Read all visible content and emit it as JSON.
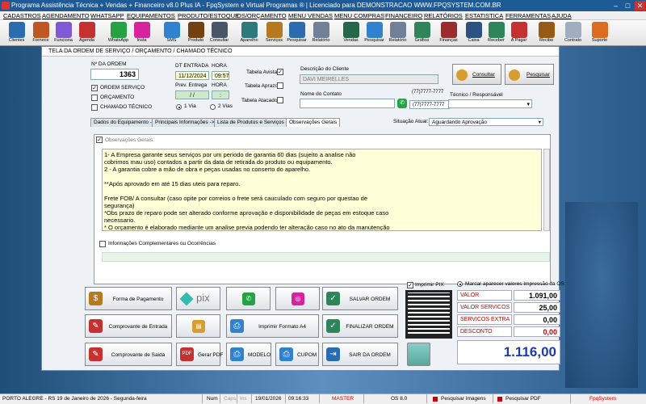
{
  "window": {
    "title": "Programa Assistência Técnica + Vendas + Financeiro v8.0 Plus IA - FpqSystem e Virtual Programas ® | Licenciado para  DEMONSTRACAO WWW.FPQSYSTEM.COM.BR"
  },
  "menu": [
    "CADASTROS",
    "AGENDAMENTO",
    "WHATSAPP",
    "EQUIPAMENTOS",
    "PRODUTO/ESTOQUE",
    "OS/ORÇAMENTO",
    "MENU VENDAS",
    "MENU COMPRAS",
    "FINANCEIRO",
    "RELATÓRIOS",
    "ESTATISTICA",
    "FERRAMENTAS",
    "AJUDA"
  ],
  "toolbar": [
    {
      "label": "Clientes",
      "icon": "clients-icon",
      "color": "#2b6cb0"
    },
    {
      "label": "Fornece",
      "icon": "suppliers-icon",
      "color": "#c05621"
    },
    {
      "label": "Funciona",
      "icon": "employees-icon",
      "color": "#805ad5"
    },
    {
      "label": "Agenda",
      "icon": "calendar-icon",
      "color": "#c53030"
    },
    {
      "label": "WhatsApp",
      "icon": "whatsapp-icon",
      "color": "#25a244"
    },
    {
      "label": "Insta",
      "icon": "instagram-icon",
      "color": "#d6249f"
    },
    {
      "label": "SMS",
      "icon": "sms-icon",
      "color": "#3182ce"
    },
    {
      "label": "Produto",
      "icon": "product-icon",
      "color": "#744210"
    },
    {
      "label": "Consultar",
      "icon": "consult-icon",
      "color": "#4a5568"
    },
    {
      "label": "Aparelho",
      "icon": "device-icon",
      "color": "#2c7a7b"
    },
    {
      "label": "Serviços",
      "icon": "services-icon",
      "color": "#b7791f"
    },
    {
      "label": "Pesquisar",
      "icon": "search-service-icon",
      "color": "#2b6cb0"
    },
    {
      "label": "Relatório",
      "icon": "report-icon",
      "color": "#718096"
    },
    {
      "label": "Vendas",
      "icon": "cart-icon",
      "color": "#276749"
    },
    {
      "label": "Pesquisar",
      "icon": "search-sales-icon",
      "color": "#3182ce"
    },
    {
      "label": "Relatório",
      "icon": "sales-report-icon",
      "color": "#718096"
    },
    {
      "label": "Gráfico",
      "icon": "chart-icon",
      "color": "#2f855a"
    },
    {
      "label": "Finanças",
      "icon": "finance-icon",
      "color": "#9b2c2c"
    },
    {
      "label": "Caixa",
      "icon": "cashier-icon",
      "color": "#2c5282"
    },
    {
      "label": "Receber",
      "icon": "receive-icon",
      "color": "#2f855a"
    },
    {
      "label": "A Pagar",
      "icon": "pay-icon",
      "color": "#c53030"
    },
    {
      "label": "Recibo",
      "icon": "receipt-icon",
      "color": "#975a16"
    },
    {
      "label": "Contrato",
      "icon": "contract-icon",
      "color": "#a0aec0"
    },
    {
      "label": "Suporte",
      "icon": "support-icon",
      "color": "#dd6b20"
    }
  ],
  "form": {
    "title": "TELA DA ORDEM DE SERVIÇO / ORÇAMENTO / CHAMADO TÉCNICO",
    "order_number_label": "Nº DA ORDEM",
    "order_number": "1363",
    "type_options": [
      {
        "label": "ORDEM SERVIÇO",
        "checked": true
      },
      {
        "label": "ORÇAMENTO",
        "checked": false
      },
      {
        "label": "CHAMADO TÉCNICO",
        "checked": false
      }
    ],
    "entry_date_label": "DT ENTRADA",
    "entry_time_label": "HORA",
    "entry_date": "11/12/2024",
    "entry_time": "09:57",
    "delivery_date_label": "Prev. Entrega",
    "delivery_time_label": "HORA",
    "delivery_date": "/  /",
    "delivery_time": ":",
    "copies": [
      {
        "label": "1 Via",
        "selected": true
      },
      {
        "label": "2 Vias",
        "selected": false
      }
    ],
    "price_tables": [
      {
        "label": "Tabela Avista",
        "checked": true
      },
      {
        "label": "Tabela Aprazo",
        "checked": false
      },
      {
        "label": "Tabela Atacado",
        "checked": false
      }
    ],
    "client_label": "Descrição do Cliente",
    "client_name": "DAVI MEIRELLES",
    "contact_label": "Nome do Contato",
    "contact_value": "",
    "phone1": "(77)7777-7777",
    "phone2": "(77)7777-7777",
    "tech_label": "Técnico / Responsável",
    "tech_value": "",
    "consult_button": "Consultar",
    "search_button": "Pesquisar",
    "tabs": [
      "Dados do Equipamento ->",
      "Principais Informações ->",
      "Lista de Produtos e Serviços ->",
      "Observações Gerais"
    ],
    "status_label": "Situação Atual:",
    "status_value": "Aguardando Aprovação",
    "obs_label": "Observações Gerais:",
    "notes": "1- A Empresa garante seus serviços por um periodo de garantia 60 dias (sujeito a analise não\ncobrimos mau uso) contados a partir da data de retirada do produto ou equipamento.\n2 - A garantia cobre a mão de obra e peças usadas no conserto do aparelho.\n\n**Após aprovado em até 15 dias uteis para reparo.\n\nFrete FOB/ A consultar (caso opite por correios o frete será cauculado com seguro por questao de\nsegurança)\n*Obs prazo de reparo pode ser alterado conforme aprovação e disponibilidade de peças em estoque caso\nnecessario.\n* O orçamento é elaborado mediante um analise previa podendo ter alteração caso no ato da manutenção\nseja identificado outro problema, peças ou quaisquer outras anomalias.",
    "complementary_label": "Informações Complementares ou Ocorrências"
  },
  "actions": {
    "payment": "Forma de Pagamento",
    "pix": "pix",
    "save": "SALVAR ORDEM",
    "entry_receipt": "Comprovante de Entrada",
    "print_a4": "Imprimir Formato A4",
    "finalize": "FINALIZAR ORDEM",
    "exit_receipt": "Comprovante de Saida",
    "pdf": "Gerar PDF",
    "model": "MODELO",
    "coupon": "CUPOM",
    "leave": "SAIR DA ORDEM",
    "print_pix_label": "Imprimir PIX",
    "show_values_label": "Marcar aparecer valores Impressão da OS"
  },
  "totals": {
    "products_label": "VALOR PRODUTOS",
    "products": "1.091,00",
    "services_label": "VALOR SERVICOS",
    "services": "25,00",
    "extra_label": "SERVICOS EXTRA",
    "extra": "0,00",
    "discount_label": "DESCONTO",
    "discount": "0,00",
    "total": "1.116,00"
  },
  "statusbar": {
    "city": "PORTO ALEGRE - RS 19 de Janeiro de 2026 - Segunda-feira",
    "num": "Num",
    "caps": "Caps",
    "ins": "Ins",
    "date": "19/01/2026",
    "time": "09:16:33",
    "user": "MASTER",
    "os": "OS 8.0",
    "search_images": "Pesquisar Imagens",
    "search_pdf": "Pesquisar PDF",
    "brand": "FpqSystem"
  }
}
